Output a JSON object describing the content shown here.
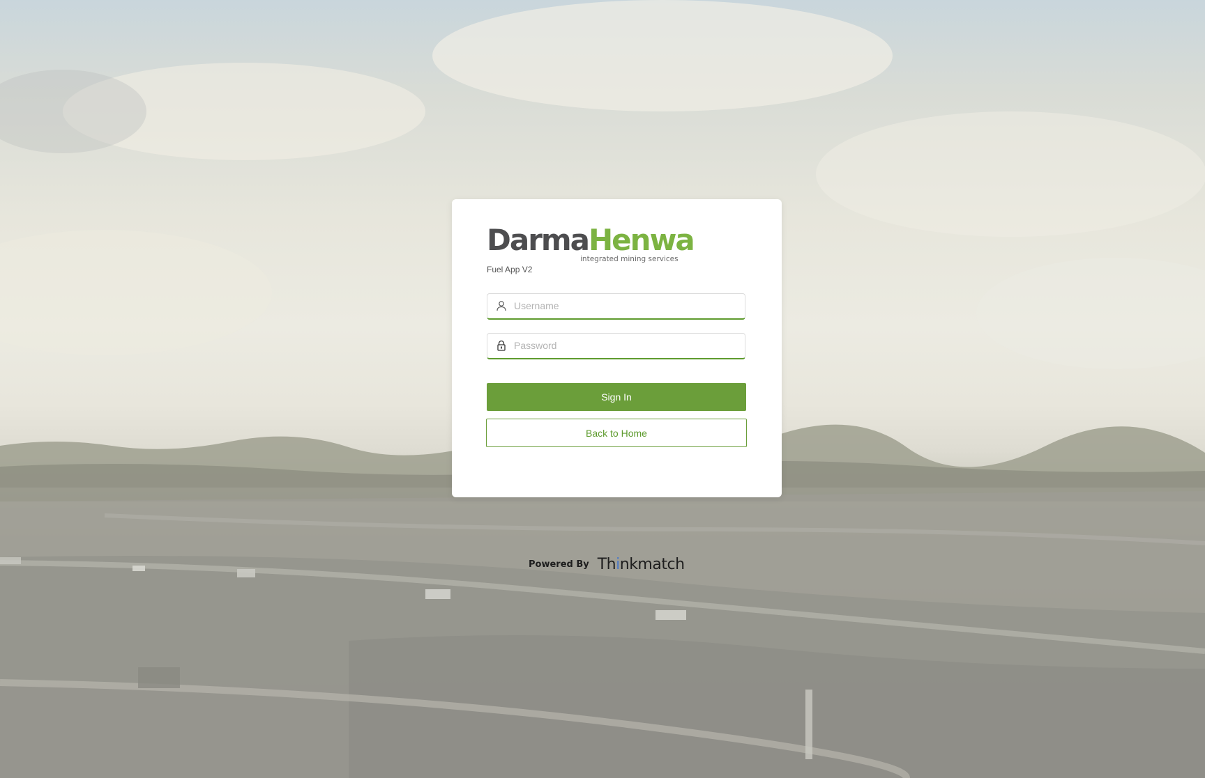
{
  "brand": {
    "logo_dark": "Darma",
    "logo_green": "Henwa",
    "tagline": "integrated mining services",
    "app_version": "Fuel App V2",
    "colors": {
      "primary_green": "#6b9e3a",
      "logo_gray": "#4d4d4f",
      "logo_green": "#7cb342"
    }
  },
  "form": {
    "username": {
      "placeholder": "Username",
      "value": "",
      "icon": "user-icon"
    },
    "password": {
      "placeholder": "Password",
      "value": "",
      "icon": "lock-icon"
    },
    "sign_in_label": "Sign In",
    "back_home_label": "Back to Home"
  },
  "footer": {
    "powered_by_label": "Powered By",
    "powered_logo_a": "Th",
    "powered_logo_b": "i",
    "powered_logo_c": "nkmatch"
  }
}
